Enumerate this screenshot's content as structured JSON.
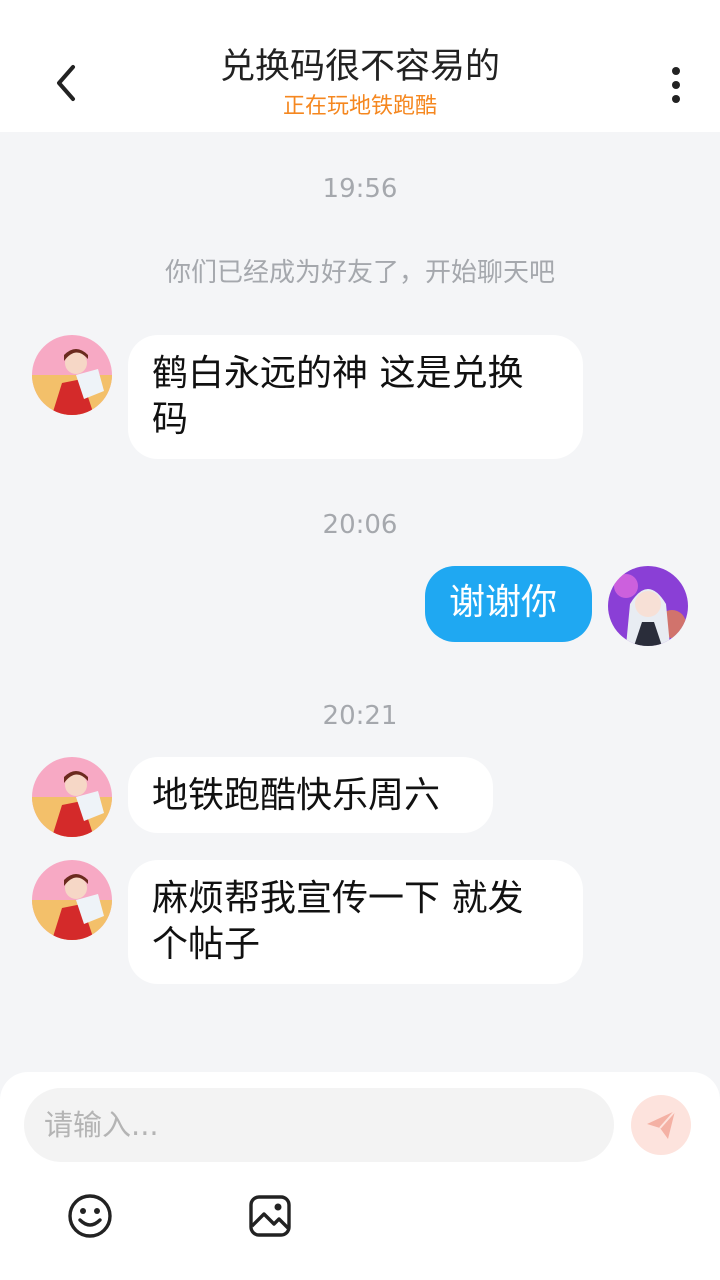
{
  "header": {
    "title": "兑换码很不容易的",
    "subtitle": "正在玩地铁跑酷",
    "back_icon": "chevron-left-icon",
    "more_icon": "more-vertical-icon"
  },
  "colors": {
    "accent_orange": "#f5871f",
    "outgoing_bubble": "#1fa8f2",
    "background": "#f4f5f7"
  },
  "chat": {
    "time_1": "19:56",
    "system_msg": "你们已经成为好友了，开始聊天吧",
    "msg_1": "鹤白永远的神 这是兑换码",
    "time_2": "20:06",
    "msg_2": "谢谢你",
    "time_3": "20:21",
    "msg_3": "地铁跑酷快乐周六",
    "msg_4": "麻烦帮我宣传一下 就发个帖子"
  },
  "composer": {
    "placeholder": "请输入...",
    "send_icon": "paper-plane-icon",
    "emoji_icon": "smiley-icon",
    "image_icon": "image-icon"
  }
}
